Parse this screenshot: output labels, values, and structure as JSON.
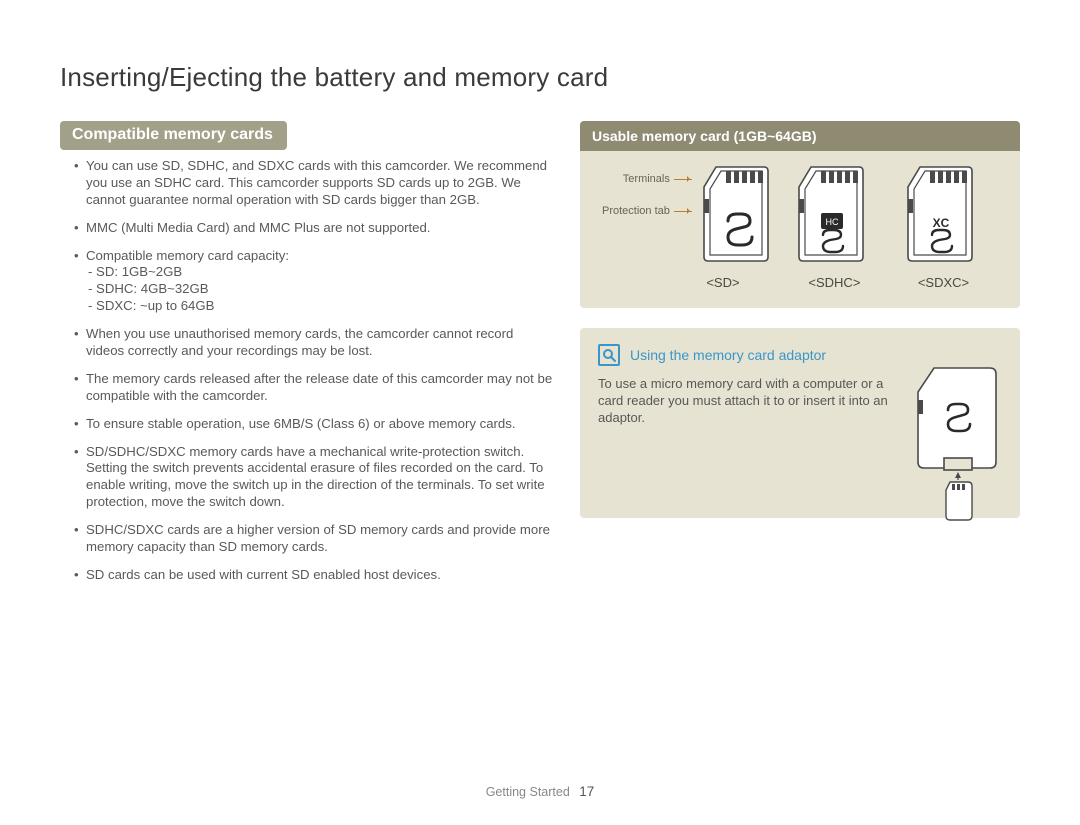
{
  "page_title": "Inserting/Ejecting the battery and memory card",
  "section_heading": "Compatible memory cards",
  "bullets": [
    {
      "text": "You can use SD, SDHC, and SDXC cards with this camcorder. We recommend you use an SDHC card. This camcorder supports SD cards up to 2GB. We cannot guarantee normal operation with SD cards bigger than 2GB."
    },
    {
      "text": "MMC (Multi Media Card) and MMC Plus are not supported."
    },
    {
      "text": "Compatible memory card capacity:",
      "subs": [
        "- SD: 1GB~2GB",
        "- SDHC: 4GB~32GB",
        "- SDXC: ~up to 64GB"
      ]
    },
    {
      "text": "When you use unauthorised memory cards, the camcorder cannot record videos correctly and your recordings may be lost."
    },
    {
      "text": "The memory cards released after the release date of this camcorder may not be compatible with the camcorder."
    },
    {
      "text": "To ensure stable operation, use 6MB/S (Class 6) or above memory cards."
    },
    {
      "text": "SD/SDHC/SDXC memory cards have a mechanical write-protection switch. Setting the switch prevents accidental erasure of files recorded on the card. To enable writing, move the switch up in the direction of the terminals. To set write protection, move the switch down."
    },
    {
      "text": "SDHC/SDXC cards are a higher version of SD memory cards and provide more memory capacity than SD memory cards."
    },
    {
      "text": "SD cards can be used with current SD enabled host devices."
    }
  ],
  "usable_box": {
    "heading": "Usable memory card (1GB~64GB)",
    "annot_terminals": "Terminals",
    "annot_protection": "Protection tab",
    "labels": {
      "sd": "<SD>",
      "sdhc": "<SDHC>",
      "sdxc": "<SDXC>"
    }
  },
  "tip": {
    "title": "Using the memory card adaptor",
    "body": "To use a micro memory card with a computer or a card reader you must attach it to or insert it into an adaptor."
  },
  "footer": {
    "section": "Getting Started",
    "page": "17"
  }
}
